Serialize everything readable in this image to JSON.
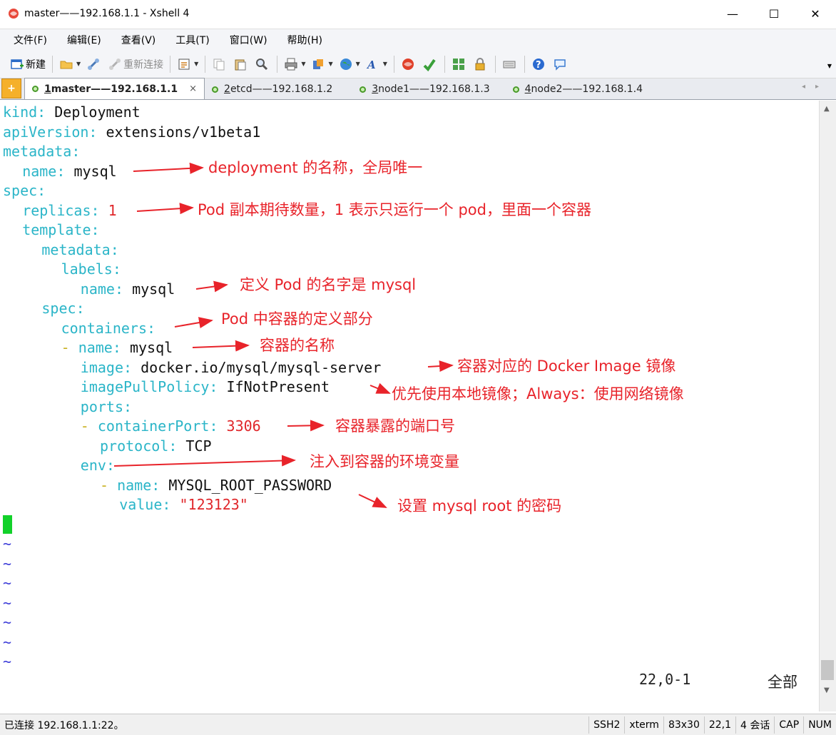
{
  "window": {
    "title": "master——192.168.1.1 - Xshell 4",
    "minimize": "—",
    "maximize": "☐",
    "close": "✕"
  },
  "menu": [
    "文件(F)",
    "编辑(E)",
    "查看(V)",
    "工具(T)",
    "窗口(W)",
    "帮助(H)"
  ],
  "toolbar": {
    "new_label": "新建",
    "reconnect_label": "重新连接"
  },
  "tabs": [
    {
      "num": "1",
      "label": " master——192.168.1.1",
      "close": "×"
    },
    {
      "num": "2",
      "label": " etcd——192.168.1.2"
    },
    {
      "num": "3",
      "label": " node1——192.168.1.3"
    },
    {
      "num": "4",
      "label": " node2——192.168.1.4"
    }
  ],
  "code": [
    {
      "key": "kind",
      "sep": ": ",
      "val": "Deployment"
    },
    {
      "key": "apiVersion",
      "sep": ": ",
      "val": "extensions/v1beta1"
    },
    {
      "key": "metadata",
      "sep": ":"
    },
    {
      "key": "name",
      "sep": ": ",
      "val": "mysql"
    },
    {
      "key": "spec",
      "sep": ":"
    },
    {
      "key": "replicas",
      "sep": ": ",
      "num": "1"
    },
    {
      "key": "template",
      "sep": ":"
    },
    {
      "key": "metadata",
      "sep": ":"
    },
    {
      "key": "labels",
      "sep": ":"
    },
    {
      "key": "name",
      "sep": ": ",
      "val": "mysql"
    },
    {
      "key": "spec",
      "sep": ":"
    },
    {
      "key": "containers",
      "sep": ":"
    },
    {
      "dash": "- ",
      "key": "name",
      "sep": ": ",
      "val": "mysql"
    },
    {
      "key": "image",
      "sep": ": ",
      "val": "docker.io/mysql/mysql-server"
    },
    {
      "key": "imagePullPolicy",
      "sep": ": ",
      "val": "IfNotPresent"
    },
    {
      "key": "ports",
      "sep": ":"
    },
    {
      "dash": "- ",
      "key": "containerPort",
      "sep": ": ",
      "num": "3306"
    },
    {
      "key": "protocol",
      "sep": ": ",
      "val": "TCP"
    },
    {
      "key": "env",
      "sep": ":"
    },
    {
      "dash": "- ",
      "key": "name",
      "sep": ": ",
      "val": "MYSQL_ROOT_PASSWORD"
    },
    {
      "key": "value",
      "sep": ": ",
      "num": "\"123123\""
    }
  ],
  "tilde": "~",
  "vim_status": {
    "position": "22,0-1",
    "scroll": "全部"
  },
  "annotations": [
    "deployment 的名称，全局唯一",
    "Pod 副本期待数量，1 表示只运行一个 pod，里面一个容器",
    "定义 Pod 的名字是 mysql",
    "Pod 中容器的定义部分",
    "容器的名称",
    "容器对应的 Docker Image 镜像",
    "优先使用本地镜像；Always：使用网络镜像",
    "容器暴露的端口号",
    "注入到容器的环境变量",
    "设置 mysql root 的密码"
  ],
  "statusbar": {
    "connection": "已连接 192.168.1.1:22。",
    "protocol": "SSH2",
    "term": "xterm",
    "size": "83x30",
    "cursor": "22,1",
    "sessions": "4 会话",
    "cap": "CAP",
    "num": "NUM"
  },
  "colors": {
    "key": "#2bb5c8",
    "annotation": "#e8232a",
    "cursor": "#12d12a",
    "tilde": "#3a3ad8",
    "number": "#e0262a"
  }
}
